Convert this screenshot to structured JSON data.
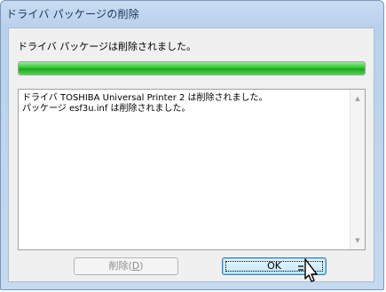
{
  "window": {
    "title": "ドライバ パッケージの削除"
  },
  "status": {
    "message": "ドライバ パッケージは削除されました。",
    "progress_percent": 100
  },
  "log": {
    "lines": [
      "ドライバ TOSHIBA Universal Printer 2 は削除されました。",
      "パッケージ esf3u.inf は削除されました。"
    ]
  },
  "buttons": {
    "delete_label": "削除(",
    "delete_mnemonic": "D",
    "delete_suffix": ")",
    "ok_label": "OK"
  },
  "colors": {
    "progress_fill": "#37c337",
    "title_text": "#1b3257",
    "window_frame": "#b9d1ec"
  },
  "icons": {
    "scroll_up": "scroll-up-arrow-icon",
    "scroll_down": "scroll-down-arrow-icon",
    "cursor": "mouse-pointer-icon"
  }
}
